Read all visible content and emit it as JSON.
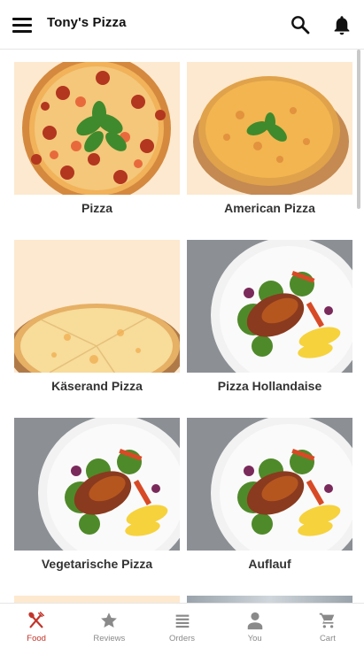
{
  "app": {
    "title": "Tony's Pizza"
  },
  "header": {
    "menu_icon": "menu-icon",
    "search_icon": "search-icon",
    "notification_icon": "bell-icon"
  },
  "categories": [
    {
      "label": "Pizza",
      "image": "pepperoni-pizza"
    },
    {
      "label": "American Pizza",
      "image": "cheese-pizza-board"
    },
    {
      "label": "Käserand Pizza",
      "image": "cheese-pizza-sliced"
    },
    {
      "label": "Pizza Hollandaise",
      "image": "chicken-salad-plate"
    },
    {
      "label": "Vegetarische Pizza",
      "image": "chicken-salad-plate"
    },
    {
      "label": "Auflauf",
      "image": "chicken-salad-plate"
    }
  ],
  "bottom_nav": [
    {
      "label": "Food",
      "icon": "fork-spoon-icon",
      "active": true
    },
    {
      "label": "Reviews",
      "icon": "star-icon",
      "active": false
    },
    {
      "label": "Orders",
      "icon": "list-icon",
      "active": false
    },
    {
      "label": "You",
      "icon": "person-icon",
      "active": false
    },
    {
      "label": "Cart",
      "icon": "cart-icon",
      "active": false
    }
  ],
  "colors": {
    "accent": "#c2342a",
    "inactive": "#8a8a8a",
    "image_bg": "#fde9cf"
  }
}
